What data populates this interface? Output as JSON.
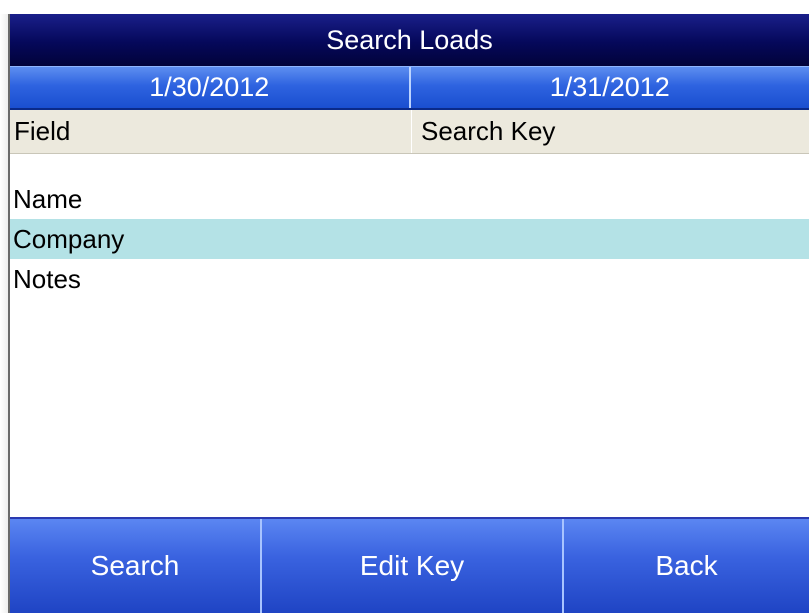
{
  "header": {
    "title": "Search Loads"
  },
  "date_range": {
    "start": "1/30/2012",
    "end": "1/31/2012"
  },
  "table": {
    "columns": [
      "Field",
      "Search Key"
    ],
    "rows": [
      {
        "field": "Name",
        "search_key": ""
      },
      {
        "field": "Company",
        "search_key": ""
      },
      {
        "field": "Notes",
        "search_key": ""
      }
    ],
    "selected_index": 1
  },
  "toolbar": {
    "search_label": "Search",
    "edit_key_label": "Edit Key",
    "back_label": "Back"
  },
  "colors": {
    "title_bar": "#05085a",
    "date_bar": "#2e63e0",
    "header_row": "#ece9dd",
    "selected_row": "#b4e2e6",
    "button_bar": "#3a63e0"
  }
}
